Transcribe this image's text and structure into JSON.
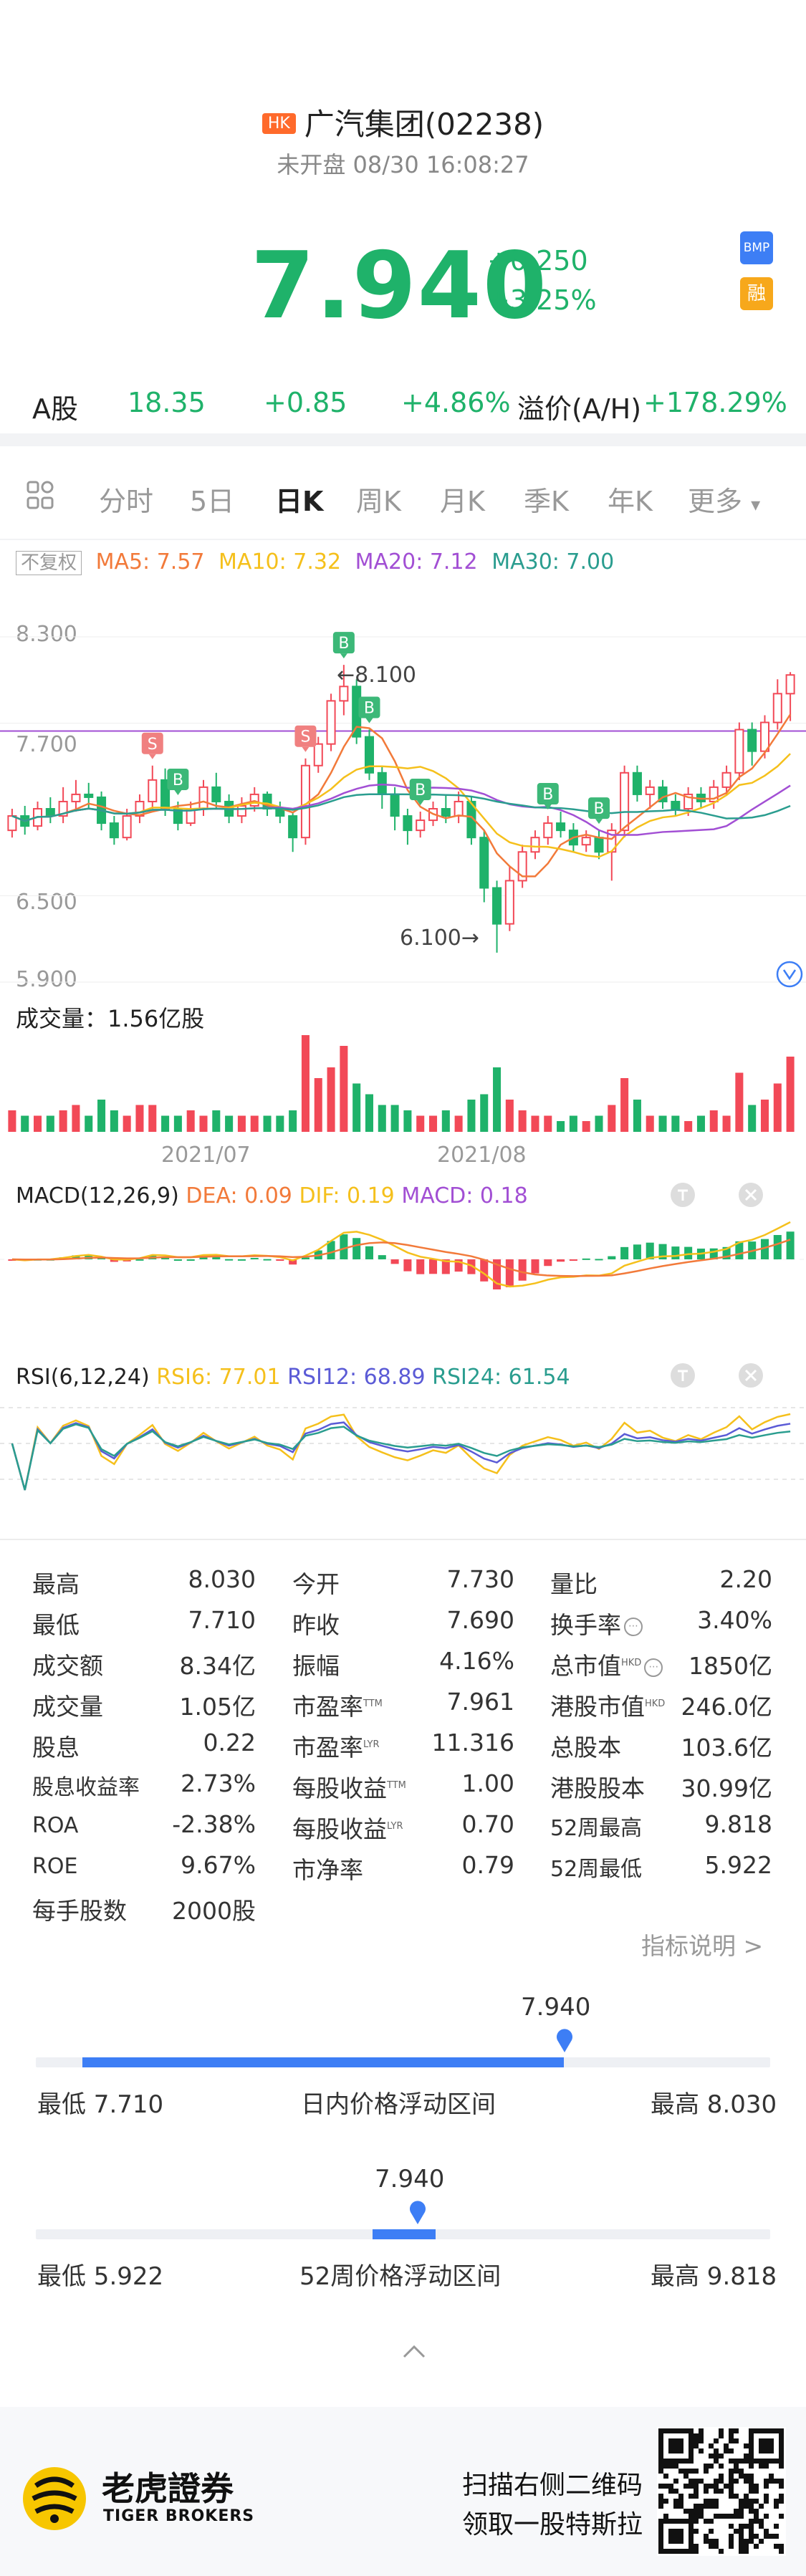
{
  "header": {
    "market_badge": "HK",
    "title": "广汽集团(02238)",
    "status": "未开盘 08/30 16:08:27",
    "price": "7.940",
    "change_abs": "+0.250",
    "change_pct": "+3.25%",
    "badge_bmp": "BMP",
    "badge_rong": "融"
  },
  "a_share": {
    "label": "A股",
    "price": "18.35",
    "change_abs": "+0.85",
    "change_pct": "+4.86%",
    "premium_label": "溢价(A/H)",
    "premium_value": "+178.29%"
  },
  "tabs": {
    "items": [
      "分时",
      "5日",
      "日K",
      "周K",
      "月K",
      "季K",
      "年K",
      "更多"
    ],
    "active": "日K"
  },
  "ma_legend": {
    "fuquan": "不复权",
    "ma5": "MA5: 7.57",
    "ma10": "MA10: 7.32",
    "ma20": "MA20: 7.12",
    "ma30": "MA30: 7.00"
  },
  "kline": {
    "y_labels": [
      "8.300",
      "7.700",
      "6.500",
      "5.900"
    ],
    "high_marker": "←8.100",
    "low_marker": "6.100→",
    "volume_label": "成交量：1.56亿股",
    "x_labels": [
      "2021/07",
      "2021/08"
    ],
    "signal_b": "B",
    "signal_s": "S"
  },
  "chart_data": {
    "type": "candlestick",
    "series": [
      {
        "name": "MA5",
        "value": 7.57
      },
      {
        "name": "MA10",
        "value": 7.32
      },
      {
        "name": "MA20",
        "value": 7.12
      },
      {
        "name": "MA30",
        "value": 7.0
      }
    ],
    "ylim": [
      5.9,
      8.3
    ],
    "period_high": 8.1,
    "period_low": 6.1,
    "candles": [
      [
        6.95,
        7.05,
        6.9,
        7.1
      ],
      [
        7.05,
        6.98,
        6.92,
        7.12
      ],
      [
        6.98,
        7.1,
        6.95,
        7.15
      ],
      [
        7.1,
        7.05,
        7.0,
        7.18
      ],
      [
        7.05,
        7.15,
        7.0,
        7.25
      ],
      [
        7.15,
        7.2,
        7.08,
        7.3
      ],
      [
        7.2,
        7.18,
        7.1,
        7.28
      ],
      [
        7.18,
        7.0,
        6.95,
        7.22
      ],
      [
        7.0,
        6.9,
        6.85,
        7.05
      ],
      [
        6.9,
        7.05,
        6.88,
        7.1
      ],
      [
        7.05,
        7.15,
        7.0,
        7.2
      ],
      [
        7.15,
        7.3,
        7.1,
        7.4
      ],
      [
        7.3,
        7.1,
        7.05,
        7.38
      ],
      [
        7.1,
        7.0,
        6.95,
        7.15
      ],
      [
        7.0,
        7.1,
        6.98,
        7.15
      ],
      [
        7.1,
        7.25,
        7.05,
        7.3
      ],
      [
        7.25,
        7.15,
        7.1,
        7.35
      ],
      [
        7.15,
        7.05,
        7.0,
        7.2
      ],
      [
        7.05,
        7.12,
        7.0,
        7.18
      ],
      [
        7.12,
        7.2,
        7.08,
        7.25
      ],
      [
        7.2,
        7.1,
        7.05,
        7.22
      ],
      [
        7.1,
        7.05,
        7.0,
        7.15
      ],
      [
        7.05,
        6.9,
        6.8,
        7.08
      ],
      [
        6.9,
        7.4,
        6.85,
        7.45
      ],
      [
        7.4,
        7.55,
        7.35,
        7.6
      ],
      [
        7.55,
        7.85,
        7.5,
        7.9
      ],
      [
        7.85,
        7.95,
        7.75,
        8.1
      ],
      [
        7.95,
        7.6,
        7.55,
        8.0
      ],
      [
        7.6,
        7.35,
        7.3,
        7.65
      ],
      [
        7.35,
        7.2,
        7.1,
        7.4
      ],
      [
        7.2,
        7.05,
        6.95,
        7.25
      ],
      [
        7.05,
        6.95,
        6.85,
        7.1
      ],
      [
        6.95,
        7.02,
        6.9,
        7.08
      ],
      [
        7.02,
        7.1,
        6.98,
        7.15
      ],
      [
        7.1,
        7.05,
        7.0,
        7.2
      ],
      [
        7.05,
        7.15,
        7.0,
        7.22
      ],
      [
        7.15,
        6.9,
        6.85,
        7.18
      ],
      [
        6.9,
        6.55,
        6.45,
        6.95
      ],
      [
        6.55,
        6.3,
        6.1,
        6.6
      ],
      [
        6.3,
        6.6,
        6.25,
        6.7
      ],
      [
        6.6,
        6.8,
        6.55,
        6.85
      ],
      [
        6.8,
        6.9,
        6.75,
        6.95
      ],
      [
        6.9,
        7.0,
        6.85,
        7.05
      ],
      [
        7.0,
        6.95,
        6.9,
        7.08
      ],
      [
        6.95,
        6.85,
        6.8,
        7.0
      ],
      [
        6.85,
        6.9,
        6.8,
        6.95
      ],
      [
        6.9,
        6.8,
        6.75,
        6.95
      ],
      [
        6.8,
        6.95,
        6.6,
        7.0
      ],
      [
        6.95,
        7.35,
        6.9,
        7.4
      ],
      [
        7.35,
        7.2,
        7.15,
        7.4
      ],
      [
        7.2,
        7.25,
        7.1,
        7.3
      ],
      [
        7.25,
        7.15,
        7.1,
        7.3
      ],
      [
        7.15,
        7.1,
        7.05,
        7.2
      ],
      [
        7.1,
        7.2,
        7.05,
        7.25
      ],
      [
        7.2,
        7.15,
        7.1,
        7.25
      ],
      [
        7.15,
        7.25,
        7.1,
        7.3
      ],
      [
        7.25,
        7.35,
        7.2,
        7.4
      ],
      [
        7.35,
        7.65,
        7.3,
        7.7
      ],
      [
        7.65,
        7.5,
        7.4,
        7.7
      ],
      [
        7.5,
        7.7,
        7.45,
        7.75
      ],
      [
        7.7,
        7.9,
        7.65,
        8.0
      ],
      [
        7.9,
        8.03,
        7.71,
        8.05
      ]
    ],
    "volume": [
      4,
      3,
      3,
      3,
      4,
      5,
      3,
      6,
      4,
      3,
      5,
      5,
      3,
      3,
      4,
      3,
      4,
      3,
      3,
      3,
      3,
      3,
      4,
      18,
      10,
      12,
      16,
      9,
      7,
      5,
      5,
      4,
      3,
      3,
      4,
      3,
      6,
      7,
      12,
      6,
      4,
      3,
      3,
      2,
      3,
      2,
      3,
      5,
      10,
      6,
      3,
      3,
      3,
      2,
      3,
      4,
      3,
      11,
      5,
      6,
      9,
      14
    ],
    "macd": {
      "label": "MACD(12,26,9)",
      "dea": "DEA: 0.09",
      "dif": "DIF: 0.19",
      "macd": "MACD: 0.18"
    },
    "rsi": {
      "label": "RSI(6,12,24)",
      "rsi6": "RSI6: 77.01",
      "rsi12": "RSI12: 68.89",
      "rsi24": "RSI24: 61.54"
    }
  },
  "stats": {
    "rows": [
      [
        [
          "最高",
          "8.030"
        ],
        [
          "今开",
          "7.730"
        ],
        [
          "量比",
          "2.20"
        ]
      ],
      [
        [
          "最低",
          "7.710"
        ],
        [
          "昨收",
          "7.690"
        ],
        [
          "换手率",
          "3.40%"
        ]
      ],
      [
        [
          "成交额",
          "8.34亿"
        ],
        [
          "振幅",
          "4.16%"
        ],
        [
          "总市值",
          "1850亿"
        ]
      ],
      [
        [
          "成交量",
          "1.05亿"
        ],
        [
          "市盈率",
          "7.961"
        ],
        [
          "港股市值",
          "246.0亿"
        ]
      ],
      [
        [
          "股息",
          "0.22"
        ],
        [
          "市盈率",
          "11.316"
        ],
        [
          "总股本",
          "103.6亿"
        ]
      ],
      [
        [
          "股息收益率",
          "2.73%"
        ],
        [
          "每股收益",
          "1.00"
        ],
        [
          "港股股本",
          "30.99亿"
        ]
      ],
      [
        [
          "ROA",
          "-2.38%"
        ],
        [
          "每股收益",
          "0.70"
        ],
        [
          "52周最高",
          "9.818"
        ]
      ],
      [
        [
          "ROE",
          "9.67%"
        ],
        [
          "市净率",
          "0.79"
        ],
        [
          "52周最低",
          "5.922"
        ]
      ],
      [
        [
          "每手股数",
          "2000股"
        ],
        null,
        null
      ]
    ],
    "sup_ttm": "TTM",
    "sup_lyr": "LYR",
    "sup_hkd": "HKD",
    "indicator_note": "指标说明 >"
  },
  "intraday_range": {
    "current": "7.940",
    "low_label": "最低 7.710",
    "title": "日内价格浮动区间",
    "high_label": "最高 8.030",
    "fraction": 0.719
  },
  "week52_range": {
    "current": "7.940",
    "low_label": "最低 5.922",
    "title": "52周价格浮动区间",
    "high_label": "最高 9.818",
    "fraction": 0.518
  },
  "footer": {
    "brand_cn": "老虎證券",
    "brand_en": "TIGER BROKERS",
    "promo_line1": "扫描右侧二维码",
    "promo_line2": "领取一股特斯拉"
  },
  "colors": {
    "up": "#f24957",
    "down": "#1fb26a",
    "ma5": "#f27a3a",
    "ma10": "#f5c01c",
    "ma20": "#a24fd4",
    "ma30": "#2a9d8f",
    "accent": "#3d7ef5"
  }
}
